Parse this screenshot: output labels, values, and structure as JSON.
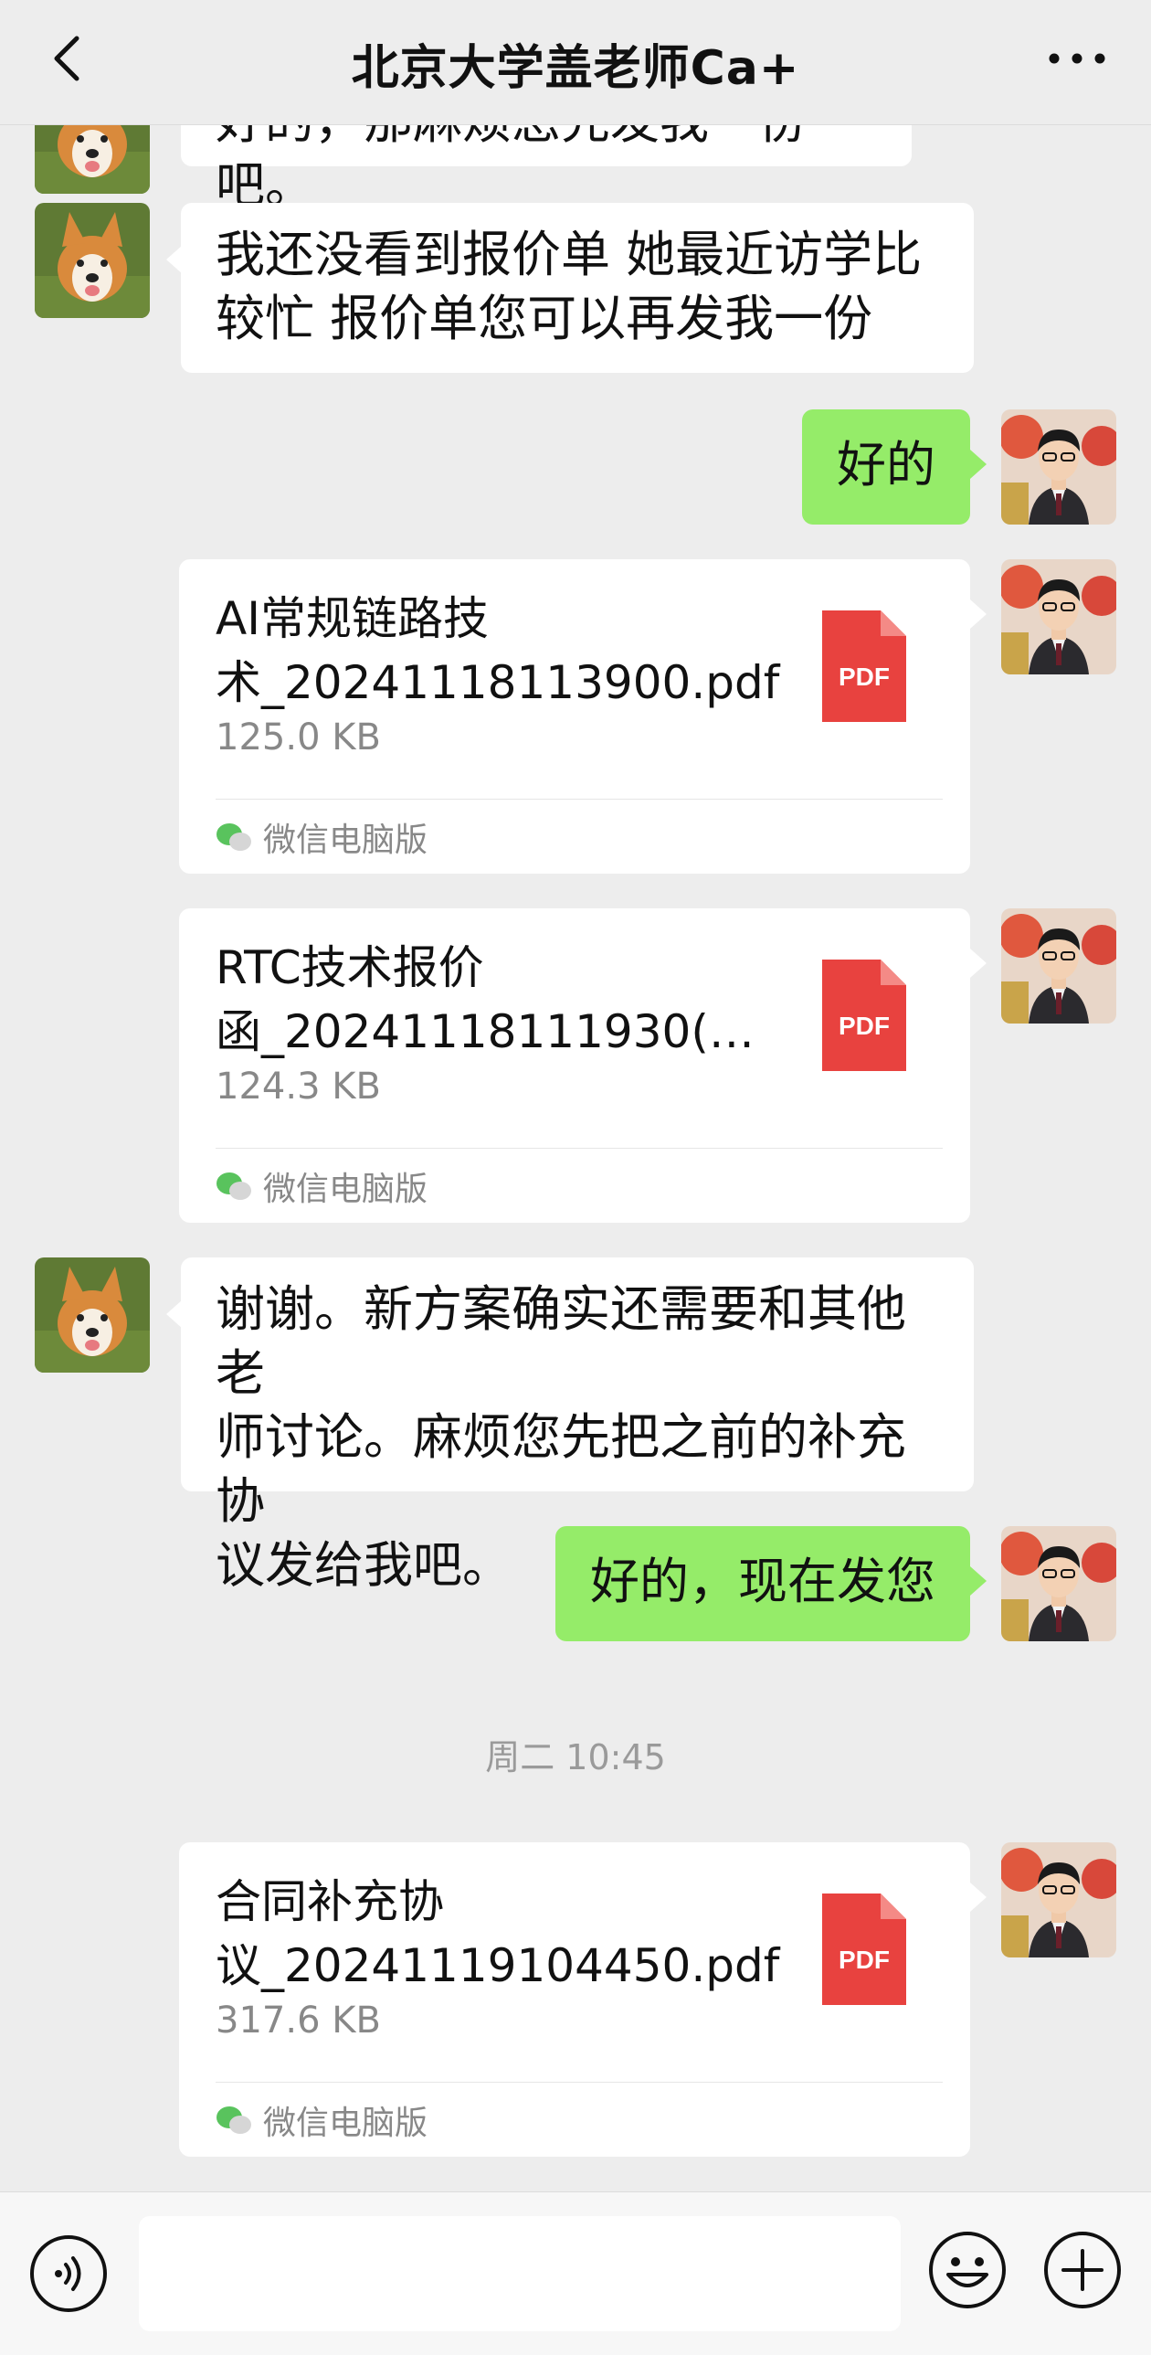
{
  "header": {
    "title": "北京大学盖老师Ca+"
  },
  "messages": [
    {
      "type": "text",
      "side": "left",
      "lines": [
        "好的，那麻烦您先发我一份吧。"
      ]
    },
    {
      "type": "text",
      "side": "left",
      "lines": [
        "我还没看到报价单 她最近访学比",
        "较忙 报价单您可以再发我一份"
      ]
    },
    {
      "type": "text",
      "side": "right",
      "lines": [
        "好的"
      ]
    },
    {
      "type": "file",
      "side": "right",
      "name_lines": [
        "AI常规链路技",
        "术_20241118113900.pdf"
      ],
      "size": "125.0 KB",
      "icon_label": "PDF",
      "source": "微信电脑版"
    },
    {
      "type": "file",
      "side": "right",
      "name_lines": [
        "RTC技术报价",
        "函_20241118111930(…"
      ],
      "size": "124.3 KB",
      "icon_label": "PDF",
      "source": "微信电脑版"
    },
    {
      "type": "text",
      "side": "left",
      "lines": [
        "谢谢。新方案确实还需要和其他老",
        "师讨论。麻烦您先把之前的补充协",
        "议发给我吧。"
      ]
    },
    {
      "type": "text",
      "side": "right",
      "lines": [
        "好的，现在发您"
      ]
    },
    {
      "type": "timestamp",
      "text": "周二 10:45"
    },
    {
      "type": "file",
      "side": "right",
      "name_lines": [
        "合同补充协",
        "议_20241119104450.pdf"
      ],
      "size": "317.6 KB",
      "icon_label": "PDF",
      "source": "微信电脑版"
    }
  ],
  "colors": {
    "background": "#ededed",
    "outgoing_bubble": "#95ec69",
    "incoming_bubble": "#ffffff",
    "pdf_red": "#e8423f"
  },
  "icons": {
    "back": "chevron-left-icon",
    "more": "more-dots-icon",
    "voice": "voice-icon",
    "emoji": "emoji-icon",
    "plus": "plus-icon"
  },
  "composer": {
    "value": ""
  }
}
